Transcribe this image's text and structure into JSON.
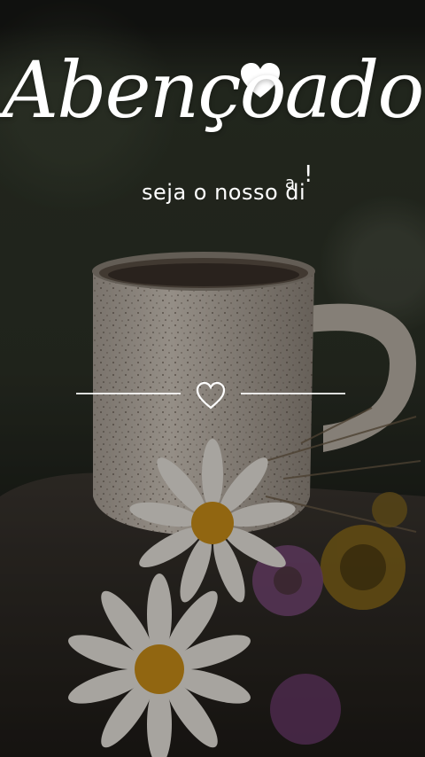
{
  "image": {
    "title": "Abençoado",
    "subtitle": "seja o nosso di",
    "subtitle_end": "a",
    "subtitle_mark": "!",
    "icons": [
      "heart-icon",
      "heart-outline-icon"
    ],
    "colors": {
      "text": "#ffffff",
      "background": "#2c3126",
      "mug": "#cfc6bb"
    }
  }
}
